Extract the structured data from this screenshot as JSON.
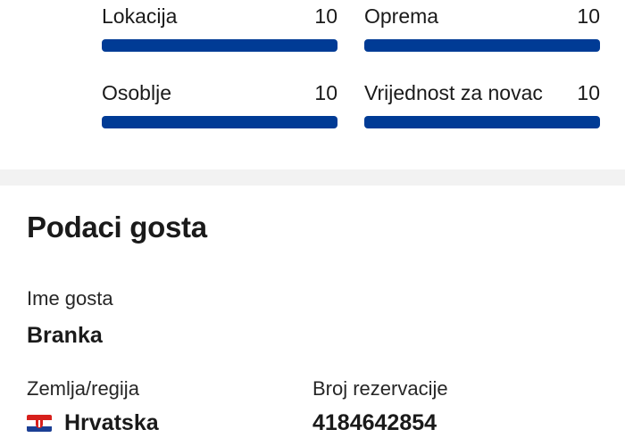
{
  "ratings": [
    {
      "label": "Lokacija",
      "score": "10",
      "fraction": 1.0
    },
    {
      "label": "Oprema",
      "score": "10",
      "fraction": 1.0
    },
    {
      "label": "Osoblje",
      "score": "10",
      "fraction": 1.0
    },
    {
      "label": "Vrijednost za novac",
      "score": "10",
      "fraction": 1.0
    }
  ],
  "colors": {
    "bar": "#003b95",
    "divider": "#f2f2f2"
  },
  "guest": {
    "title": "Podaci gosta",
    "name_label": "Ime gosta",
    "name_value": "Branka",
    "country_label": "Zemlja/regija",
    "country_value": "Hrvatska",
    "country_flag_icon": "croatia-flag-icon",
    "booking_label": "Broj rezervacije",
    "booking_value": "4184642854"
  }
}
